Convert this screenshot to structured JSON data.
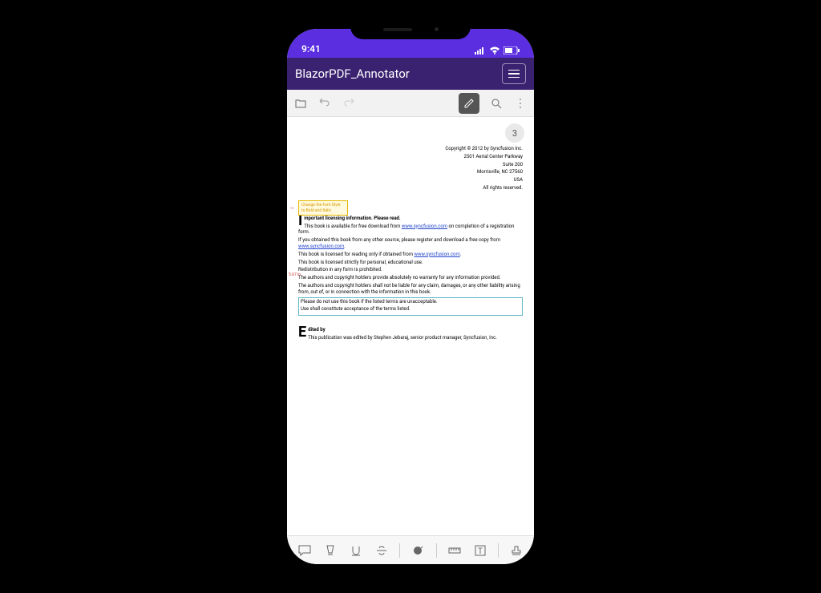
{
  "status": {
    "time": "9:41"
  },
  "header": {
    "title": "BlazorPDF_Annotator"
  },
  "page": {
    "number": "3"
  },
  "annotation": {
    "note": "Change the Font Style to Bold and Italic"
  },
  "measure": {
    "label": "5.67 in"
  },
  "doc": {
    "copyright": "Copyright © 2012 by Syncfusion Inc.",
    "addr1": "2501 Aerial Center Parkway",
    "addr2": "Suite 200",
    "addr3": "Morrisville, NC 27560",
    "addr4": "USA",
    "rights": "All rights reserved.",
    "h1": "mportant licensing information. Please read.",
    "p1a": "This book is available for free download from ",
    "link1": "www.syncfusion.com",
    "p1b": " on completion of a registration form.",
    "p2": "If you obtained this book from any other source, please register and download a free copy from ",
    "link2": "www.syncfusion.com",
    "p3a": "This book is licensed for reading only if obtained from ",
    "link3": "www.syncfusion.com",
    "p4": "This book is licensed strictly for personal, educational use.",
    "p5": "Redistribution in any form is prohibited.",
    "p6": "The authors and copyright holders provide absolutely no warranty for any information provided.",
    "p7": "The authors and copyright holders shall not be liable for any claim, damages, or any other liability arising from, out of, or in connection with the information in this book.",
    "p8": "Please do not use this book if the listed terms are unacceptable.",
    "p9": "Use shall constitute acceptance of the terms listed.",
    "editedH": "dited by",
    "edited": "This publication was edited by Stephen Jebaraj, senior product manager, Syncfusion, Inc."
  }
}
